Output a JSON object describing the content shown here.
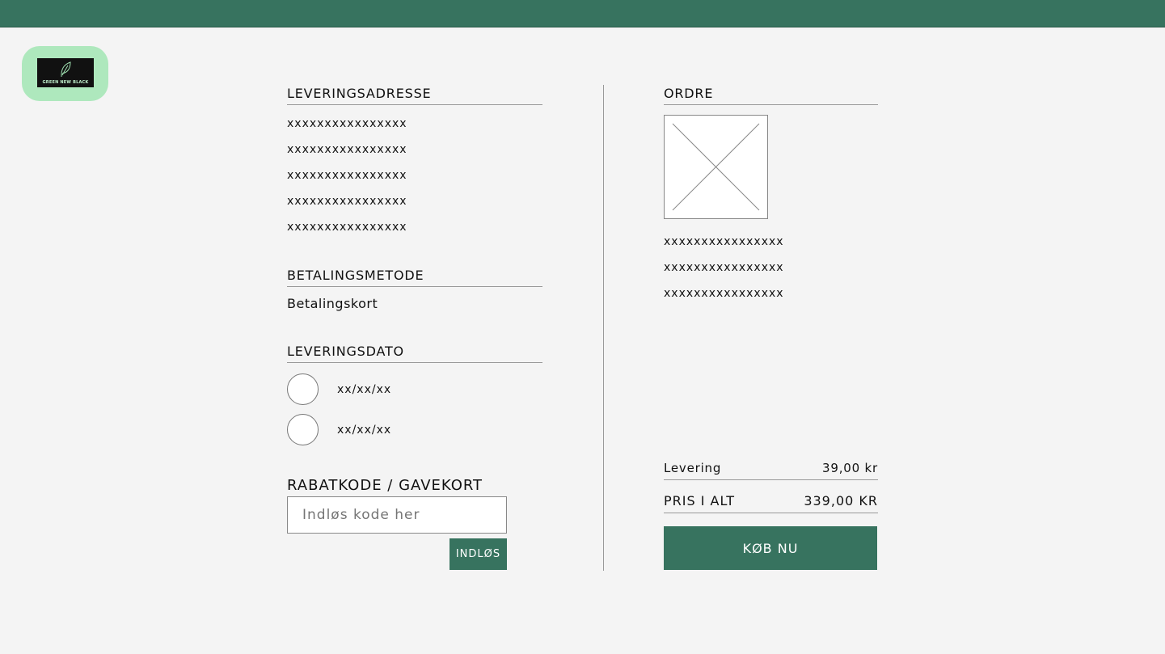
{
  "brand": {
    "logo_text": "GREEN NEW BLACK"
  },
  "delivery_address": {
    "heading": "LEVERINGSADRESSE",
    "lines": [
      "xxxxxxxxxxxxxxxx",
      "xxxxxxxxxxxxxxxx",
      "xxxxxxxxxxxxxxxx",
      "xxxxxxxxxxxxxxxx",
      "xxxxxxxxxxxxxxxx"
    ]
  },
  "payment": {
    "heading": "BETALINGSMETODE",
    "value": "Betalingskort"
  },
  "delivery_date": {
    "heading": "LEVERINGSDATO",
    "options": [
      "xx/xx/xx",
      "xx/xx/xx"
    ]
  },
  "discount": {
    "heading": "RABATKODE / GAVEKORT",
    "placeholder": "Indløs kode her",
    "button": "INDLØS"
  },
  "order": {
    "heading": "ORDRE",
    "lines": [
      "xxxxxxxxxxxxxxxx",
      "xxxxxxxxxxxxxxxx",
      "xxxxxxxxxxxxxxxx"
    ],
    "shipping_label": "Levering",
    "shipping_value": "39,00 kr",
    "total_label": "PRIS I ALT",
    "total_value": "339,00 KR",
    "buy_button": "KØB NU"
  },
  "colors": {
    "accent": "#37735f",
    "logo_bg": "#aee8bd"
  }
}
